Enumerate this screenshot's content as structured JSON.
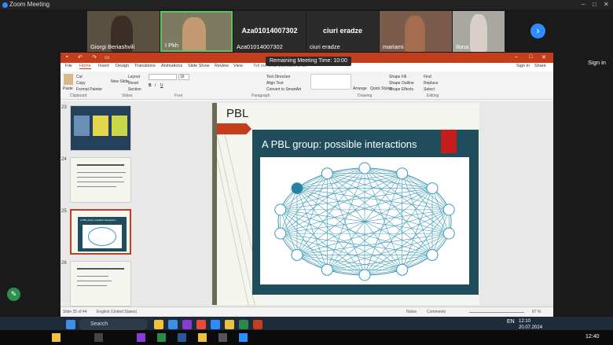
{
  "window": {
    "title": "Zoom Meeting"
  },
  "participants": [
    {
      "name": "Giorgi Beriashvili"
    },
    {
      "name": "I Pkh"
    },
    {
      "name": "Aza01014007302",
      "big": "Aza01014007302"
    },
    {
      "name": "ciuri eradze",
      "big": "ciuri eradze"
    },
    {
      "name": "mariami"
    },
    {
      "name": "Ilona"
    }
  ],
  "zoom": {
    "sign_in": "Sign in",
    "timer": "Remaining Meeting Time: 10:00"
  },
  "ppt": {
    "title_bar": "",
    "signin": "Sign in",
    "share": "Share",
    "tell_me": "Tell me what you want to do",
    "tabs": [
      "File",
      "Home",
      "Insert",
      "Design",
      "Transitions",
      "Animations",
      "Slide Show",
      "Review",
      "View"
    ],
    "ribbon": {
      "paste": "Paste",
      "cut": "Cut",
      "copy": "Copy",
      "format_painter": "Format Painter",
      "clipboard": "Clipboard",
      "new_slide": "New Slide",
      "layout": "Layout",
      "reset": "Reset",
      "section": "Section",
      "slides": "Slides",
      "font_group": "Font",
      "paragraph": "Paragraph",
      "text_direction": "Text Direction",
      "align_text": "Align Text",
      "convert_smartart": "Convert to SmartArt",
      "drawing": "Drawing",
      "arrange": "Arrange",
      "quick_styles": "Quick Styles",
      "shape_fill": "Shape Fill",
      "shape_outline": "Shape Outline",
      "shape_effects": "Shape Effects",
      "find": "Find",
      "replace": "Replace",
      "select": "Select",
      "editing": "Editing",
      "font_size": "18"
    },
    "thumbnails": [
      {
        "num": "23"
      },
      {
        "num": "24"
      },
      {
        "num": "25",
        "caption": "A PBL group: possible interactions"
      },
      {
        "num": "26"
      }
    ],
    "slide": {
      "title": "PBL",
      "heading": "A PBL group: possible interactions"
    },
    "status": {
      "slide_info": "Slide 25 of 44",
      "language": "English (United States)",
      "notes": "Notes",
      "comments": "Comments",
      "zoom": "87 %"
    }
  },
  "taskbar": {
    "search": "Search",
    "lang": "EN",
    "time": "12:10",
    "date": "20.07.2024",
    "clock": "12:40"
  },
  "colors": {
    "ppt_accent": "#c43e1c",
    "zoom_blue": "#2d8cff",
    "slide_dark": "#1f4d5c",
    "network": "#3a9ab8"
  }
}
